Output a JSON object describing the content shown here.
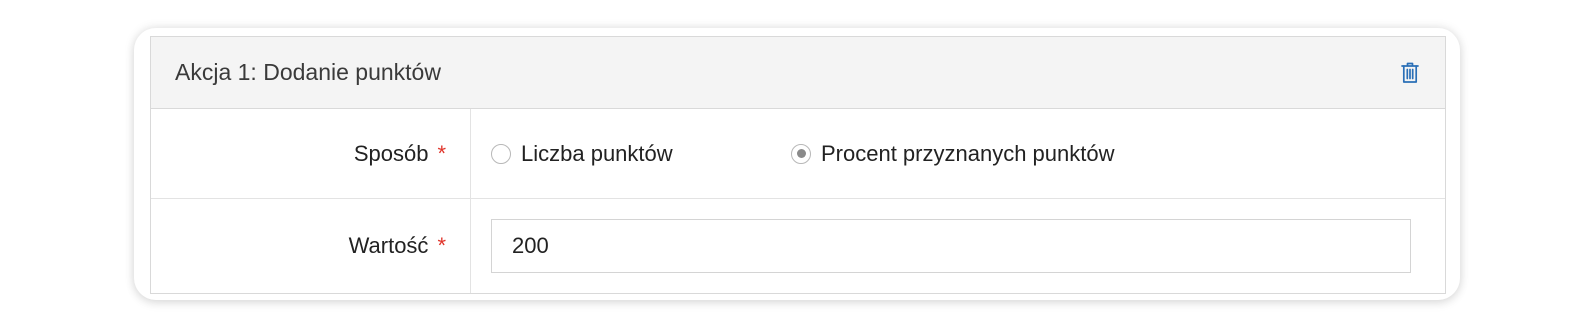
{
  "action_panel": {
    "title": "Akcja 1: Dodanie punktów",
    "delete_icon": "trash-icon",
    "accent_color": "#2a6fb7"
  },
  "method_row": {
    "label": "Sposób",
    "required_mark": "*",
    "options": [
      {
        "label": "Liczba punktów",
        "selected": false
      },
      {
        "label": "Procent przyznanych punktów",
        "selected": true
      }
    ]
  },
  "value_row": {
    "label": "Wartość",
    "required_mark": "*",
    "value": "200"
  }
}
